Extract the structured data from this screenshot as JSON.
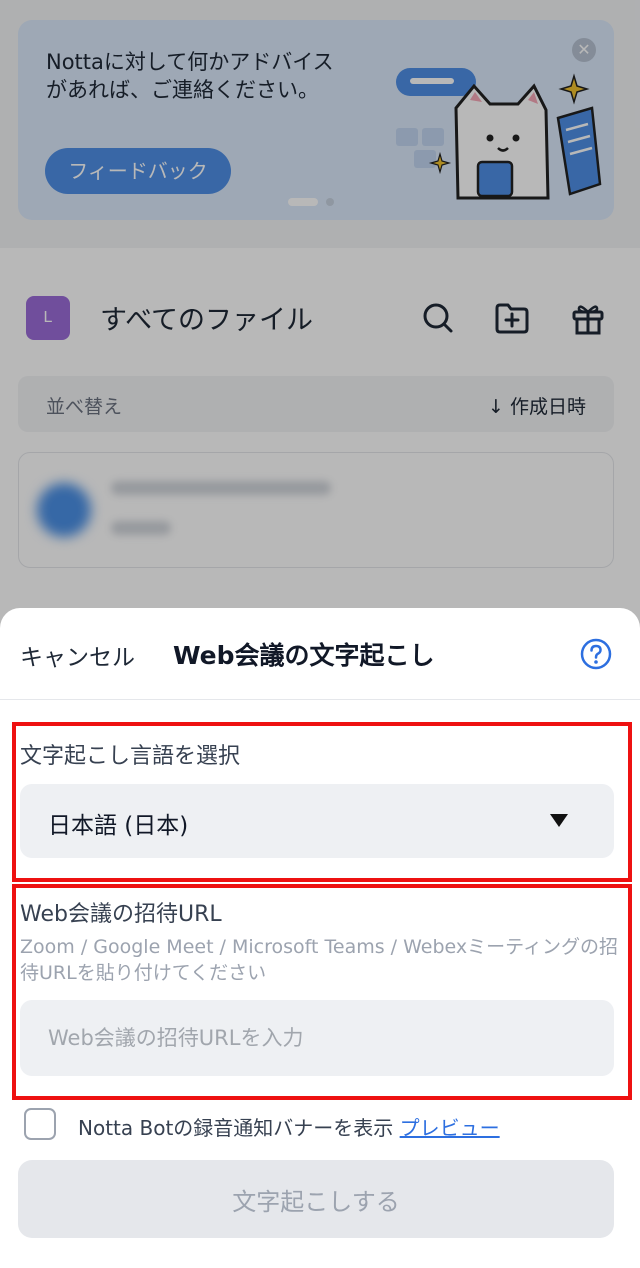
{
  "promo": {
    "text_line1": "Nottaに対して何かアドバイス",
    "text_line2": "があれば、ご連絡ください。",
    "button": "フィードバック",
    "close_icon": "close-icon",
    "carousel_pages": 2,
    "carousel_active": 1
  },
  "files": {
    "avatar_letter": "L",
    "title": "すべてのファイル",
    "icons": [
      "search-icon",
      "new-folder-icon",
      "gift-icon"
    ],
    "sort_label": "並べ替え",
    "sort_value": "↓ 作成日時"
  },
  "sheet": {
    "cancel": "キャンセル",
    "title": "Web会議の文字起こし",
    "help_icon": "help-icon",
    "language_label": "文字起こし言語を選択",
    "language_value": "日本語 (日本)",
    "url_label": "Web会議の招待URL",
    "url_hint": "Zoom / Google Meet / Microsoft Teams / Webexミーティングの招待URLを貼り付けてください",
    "url_placeholder": "Web会議の招待URLを入力",
    "url_value": "",
    "checkbox_label": "Notta Botの録音通知バナーを表示",
    "checkbox_checked": false,
    "preview_link": "プレビュー",
    "submit": "文字起こしする"
  },
  "colors": {
    "highlight": "#ee1111",
    "link": "#2d6fe0",
    "promo_bg": "#dbe9fb",
    "promo_button": "#4f8fe6",
    "avatar": "#9b6cd8"
  }
}
